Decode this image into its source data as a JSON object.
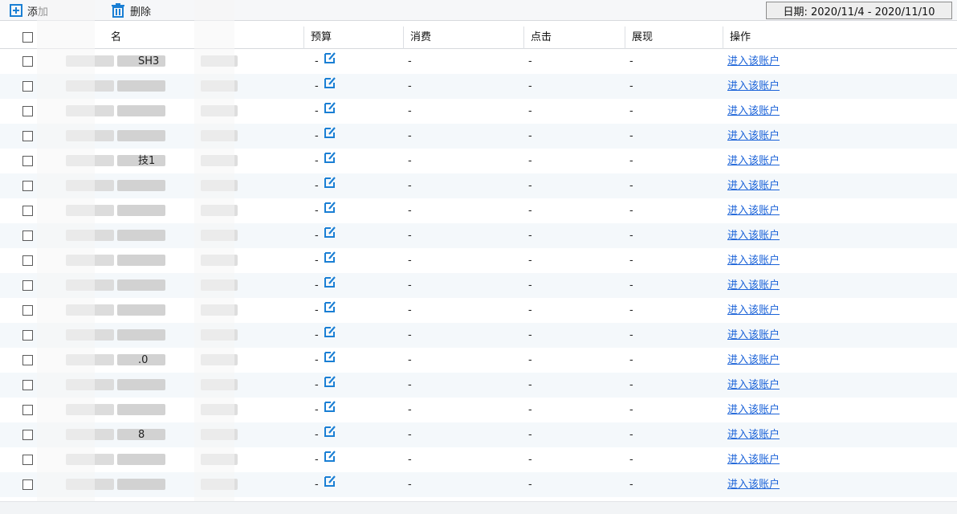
{
  "toolbar": {
    "add_label": "添加",
    "delete_label": "删除",
    "date_label": "日期: 2020/11/4 - 2020/11/10"
  },
  "table": {
    "headers": {
      "name": "名",
      "budget": "预算",
      "consumption": "消费",
      "clicks": "点击",
      "impressions": "展现",
      "operation": "操作"
    },
    "rows": [
      {
        "name": "SH3",
        "budget": "-",
        "consumption": "-",
        "clicks": "-",
        "impressions": "-",
        "action": "进入该账户"
      },
      {
        "name": "",
        "budget": "-",
        "consumption": "-",
        "clicks": "-",
        "impressions": "-",
        "action": "进入该账户"
      },
      {
        "name": "",
        "budget": "-",
        "consumption": "-",
        "clicks": "-",
        "impressions": "-",
        "action": "进入该账户"
      },
      {
        "name": "",
        "budget": "-",
        "consumption": "-",
        "clicks": "-",
        "impressions": "-",
        "action": "进入该账户"
      },
      {
        "name": "技1",
        "budget": "-",
        "consumption": "-",
        "clicks": "-",
        "impressions": "-",
        "action": "进入该账户"
      },
      {
        "name": "",
        "budget": "-",
        "consumption": "-",
        "clicks": "-",
        "impressions": "-",
        "action": "进入该账户"
      },
      {
        "name": "",
        "budget": "-",
        "consumption": "-",
        "clicks": "-",
        "impressions": "-",
        "action": "进入该账户"
      },
      {
        "name": "",
        "budget": "-",
        "consumption": "-",
        "clicks": "-",
        "impressions": "-",
        "action": "进入该账户"
      },
      {
        "name": "",
        "budget": "-",
        "consumption": "-",
        "clicks": "-",
        "impressions": "-",
        "action": "进入该账户"
      },
      {
        "name": "",
        "budget": "-",
        "consumption": "-",
        "clicks": "-",
        "impressions": "-",
        "action": "进入该账户"
      },
      {
        "name": "",
        "budget": "-",
        "consumption": "-",
        "clicks": "-",
        "impressions": "-",
        "action": "进入该账户"
      },
      {
        "name": "",
        "budget": "-",
        "consumption": "-",
        "clicks": "-",
        "impressions": "-",
        "action": "进入该账户"
      },
      {
        "name": ".0",
        "budget": "-",
        "consumption": "-",
        "clicks": "-",
        "impressions": "-",
        "action": "进入该账户"
      },
      {
        "name": "",
        "budget": "-",
        "consumption": "-",
        "clicks": "-",
        "impressions": "-",
        "action": "进入该账户"
      },
      {
        "name": "",
        "budget": "-",
        "consumption": "-",
        "clicks": "-",
        "impressions": "-",
        "action": "进入该账户"
      },
      {
        "name": "8",
        "budget": "-",
        "consumption": "-",
        "clicks": "-",
        "impressions": "-",
        "action": "进入该账户"
      },
      {
        "name": "",
        "budget": "-",
        "consumption": "-",
        "clicks": "-",
        "impressions": "-",
        "action": "进入该账户"
      },
      {
        "name": "",
        "budget": "-",
        "consumption": "-",
        "clicks": "-",
        "impressions": "-",
        "action": "进入该账户"
      }
    ]
  },
  "colors": {
    "accent": "#1a7fd4",
    "link": "#1a62d8"
  },
  "icons": {
    "add": "plus-square-icon",
    "delete": "trash-icon",
    "edit": "edit-icon"
  }
}
